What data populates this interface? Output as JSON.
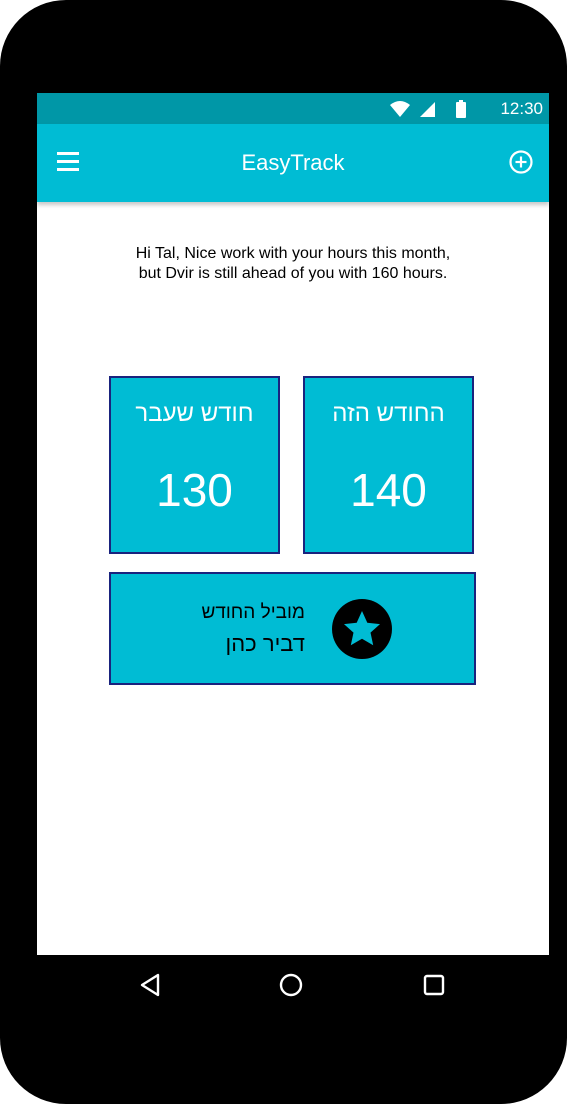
{
  "status_bar": {
    "time": "12:30",
    "icons": [
      "wifi-icon",
      "signal-icon",
      "battery-icon"
    ]
  },
  "app_bar": {
    "title": "EasyTrack",
    "left_icon": "menu-icon",
    "right_icon": "add-circle-icon"
  },
  "greeting": {
    "line1": "Hi Tal, Nice work with your hours this month,",
    "line2": "but Dvir is still ahead of you with 160 hours."
  },
  "stats": {
    "this_month": {
      "label": "החודש הזה",
      "value": "140"
    },
    "last_month": {
      "label": "חודש שעבר",
      "value": "130"
    }
  },
  "leader": {
    "caption": "מוביל החודש",
    "name": "דביר כהן",
    "icon": "star-icon"
  },
  "nav": {
    "icons": [
      "back-icon",
      "home-icon",
      "recents-icon"
    ]
  },
  "colors": {
    "status_bar": "#0097a7",
    "app_bar": "#00bcd4",
    "card": "#00bcd4",
    "card_border": "#1a237e",
    "device": "#000000"
  }
}
